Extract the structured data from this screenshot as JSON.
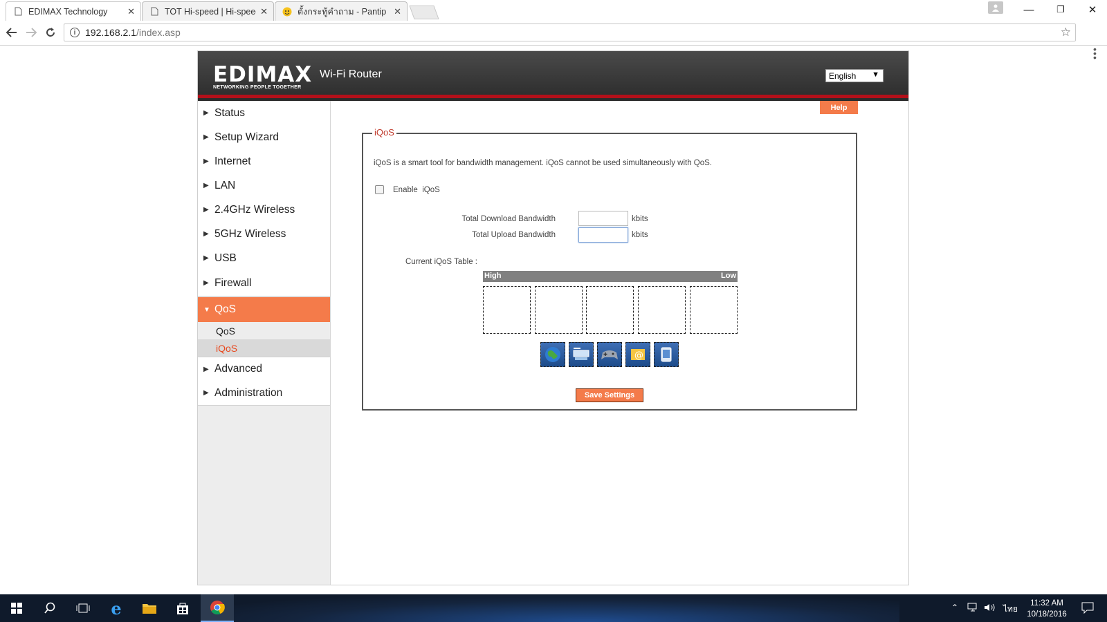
{
  "browser": {
    "tabs": [
      {
        "title": "EDIMAX Technology",
        "active": true
      },
      {
        "title": "TOT Hi-speed | Hi-speed",
        "active": false
      },
      {
        "title": "ตั้งกระทู้คำถาม - Pantip",
        "active": false
      }
    ],
    "address": {
      "host": "192.168.2.1",
      "path": "/index.asp"
    }
  },
  "router": {
    "brand": "EDIMAX",
    "tagline": "NETWORKING PEOPLE TOGETHER",
    "product": "Wi-Fi Router",
    "language": "English",
    "help_label": "Help",
    "nav": [
      {
        "label": "Status"
      },
      {
        "label": "Setup Wizard"
      },
      {
        "label": "Internet"
      },
      {
        "label": "LAN"
      },
      {
        "label": "2.4GHz Wireless"
      },
      {
        "label": "5GHz Wireless"
      },
      {
        "label": "USB"
      },
      {
        "label": "Firewall"
      },
      {
        "label": "QoS",
        "expanded": true
      },
      {
        "label": "Advanced"
      },
      {
        "label": "Administration"
      }
    ],
    "qos_sub": [
      {
        "label": "QoS",
        "selected": false
      },
      {
        "label": "iQoS",
        "selected": true
      }
    ],
    "panel": {
      "legend": "iQoS",
      "description": "iQoS is a smart tool for bandwidth management. iQoS cannot be used simultaneously with QoS.",
      "enable_label": "Enable  iQoS",
      "enable_checked": false,
      "download_label": "Total Download Bandwidth",
      "download_value": "",
      "upload_label": "Total Upload Bandwidth",
      "upload_value": "",
      "unit": "kbits",
      "table_label": "Current iQoS Table :",
      "priority_high": "High",
      "priority_low": "Low",
      "app_icons": [
        "globe-icon",
        "network-transfer-icon",
        "game-controller-icon",
        "email-icon",
        "mobile-device-icon"
      ],
      "save_label": "Save Settings"
    },
    "colors": {
      "accent": "#f47b4a",
      "header": "#333333",
      "brand_red": "#b3101a"
    }
  },
  "taskbar": {
    "time": "11:32 AM",
    "date": "10/18/2016",
    "ime": "ไทย"
  }
}
